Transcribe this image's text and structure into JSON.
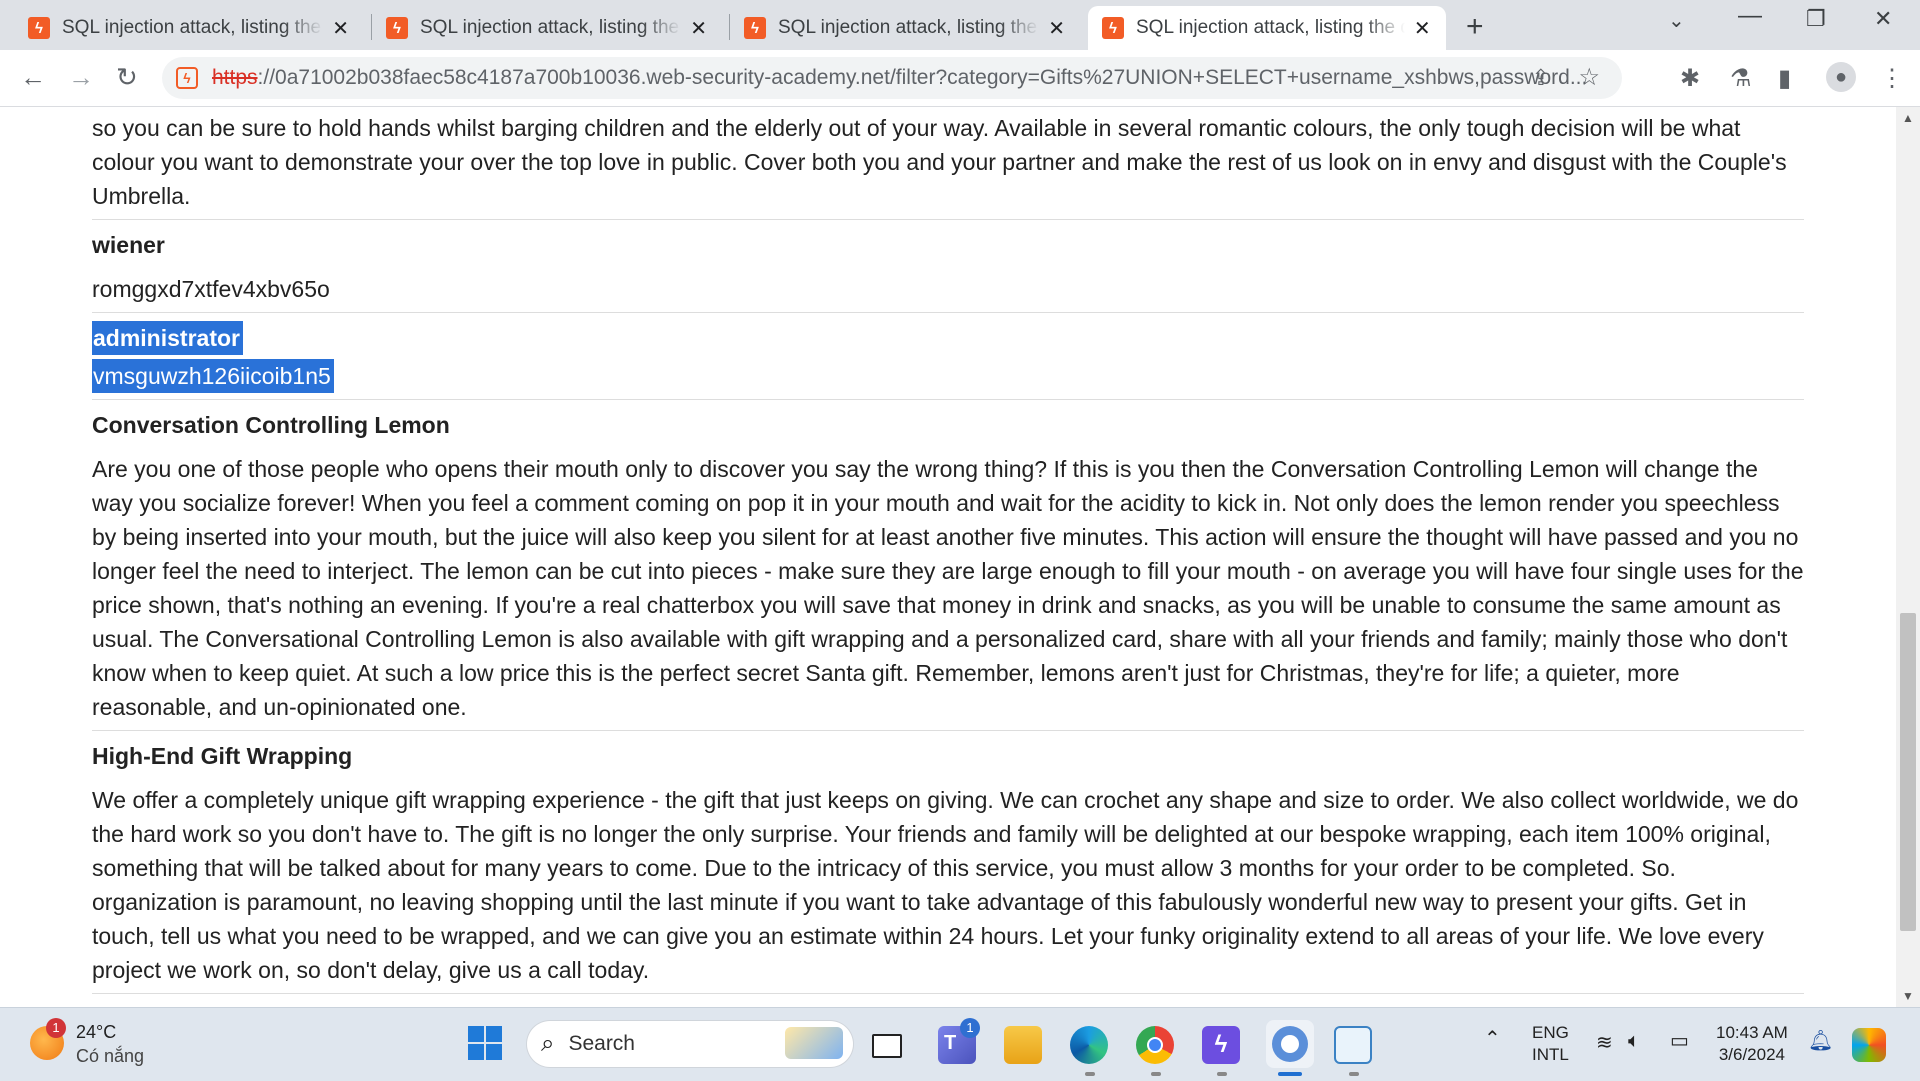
{
  "browser": {
    "tabs": [
      {
        "title": "SQL injection attack, listing the d"
      },
      {
        "title": "SQL injection attack, listing the d"
      },
      {
        "title": "SQL injection attack, listing the d"
      },
      {
        "title": "SQL injection attack, listing the d"
      }
    ],
    "tab_close": "✕",
    "new_tab": "+",
    "url_scheme": "https",
    "url_rest": "://0a71002b038faec58c4187a700b10036.web-security-academy.net/filter?category=Gifts%27UNION+SELECT+username_xshbws,password..."
  },
  "page": {
    "intro_text": "so you can be sure to hold hands whilst barging children and the elderly out of your way. Available in several romantic colours, the only tough decision will be what colour you want to demonstrate your over the top love in public. Cover both you and your partner and make the rest of us look on in envy and disgust with the Couple's Umbrella.",
    "rows": [
      {
        "name": "wiener",
        "value": "romggxd7xtfev4xbv65o"
      },
      {
        "name": "administrator",
        "value": "vmsguwzh126iicoib1n5"
      }
    ],
    "products": [
      {
        "name": "Conversation Controlling Lemon",
        "description": "Are you one of those people who opens their mouth only to discover you say the wrong thing? If this is you then the Conversation Controlling Lemon will change the way you socialize forever! When you feel a comment coming on pop it in your mouth and wait for the acidity to kick in. Not only does the lemon render you speechless by being inserted into your mouth, but the juice will also keep you silent for at least another five minutes. This action will ensure the thought will have passed and you no longer feel the need to interject. The lemon can be cut into pieces - make sure they are large enough to fill your mouth - on average you will have four single uses for the price shown, that's nothing an evening. If you're a real chatterbox you will save that money in drink and snacks, as you will be unable to consume the same amount as usual. The Conversational Controlling Lemon is also available with gift wrapping and a personalized card, share with all your friends and family; mainly those who don't know when to keep quiet. At such a low price this is the perfect secret Santa gift. Remember, lemons aren't just for Christmas, they're for life; a quieter, more reasonable, and un-opinionated one."
      },
      {
        "name": "High-End Gift Wrapping",
        "description": "We offer a completely unique gift wrapping experience - the gift that just keeps on giving. We can crochet any shape and size to order. We also collect worldwide, we do the hard work so you don't have to. The gift is no longer the only surprise. Your friends and family will be delighted at our bespoke wrapping, each item 100% original, something that will be talked about for many years to come. Due to the intricacy of this service, you must allow 3 months for your order to be completed. So. organization is paramount, no leaving shopping until the last minute if you want to take advantage of this fabulously wonderful new way to present your gifts. Get in touch, tell us what you need to be wrapped, and we can give you an estimate within 24 hours. Let your funky originality extend to all areas of your life. We love every project we work on, so don't delay, give us a call today."
      }
    ]
  },
  "taskbar": {
    "weather_temp": "24°C",
    "weather_desc": "Có nắng",
    "weather_badge": "1",
    "search_label": "Search",
    "teams_badge": "1",
    "lang_top": "ENG",
    "lang_bottom": "INTL",
    "time": "10:43 AM",
    "date": "3/6/2024"
  },
  "colors": {
    "favicon": "#f25c26",
    "selection": "#2a72d8",
    "taskbar": "#dfe6ee"
  }
}
